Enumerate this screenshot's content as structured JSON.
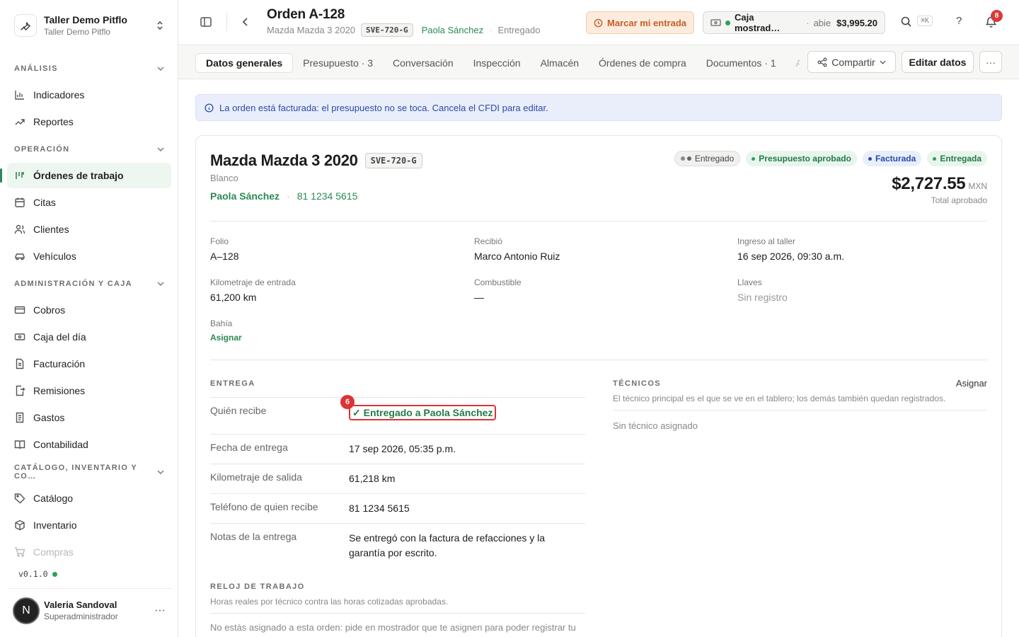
{
  "workspace": {
    "name": "Taller Demo Pitflo",
    "subtitle": "Taller Demo Pitflo"
  },
  "sidebar": {
    "sections": [
      {
        "title": "ANÁLISIS",
        "items": [
          {
            "label": "Indicadores",
            "icon": "bar-chart-icon"
          },
          {
            "label": "Reportes",
            "icon": "trend-icon"
          }
        ]
      },
      {
        "title": "OPERACIÓN",
        "items": [
          {
            "label": "Órdenes de trabajo",
            "icon": "kanban-icon",
            "active": true
          },
          {
            "label": "Citas",
            "icon": "calendar-icon"
          },
          {
            "label": "Clientes",
            "icon": "users-icon"
          },
          {
            "label": "Vehículos",
            "icon": "car-icon"
          }
        ]
      },
      {
        "title": "ADMINISTRACIÓN Y CAJA",
        "items": [
          {
            "label": "Cobros",
            "icon": "banknote-icon"
          },
          {
            "label": "Caja del día",
            "icon": "cash-icon"
          },
          {
            "label": "Facturación",
            "icon": "file-icon"
          },
          {
            "label": "Remisiones",
            "icon": "file-export-icon"
          },
          {
            "label": "Gastos",
            "icon": "receipt-icon"
          },
          {
            "label": "Contabilidad",
            "icon": "book-icon"
          }
        ]
      },
      {
        "title": "CATÁLOGO, INVENTARIO Y CO…",
        "items": [
          {
            "label": "Catálogo",
            "icon": "tag-icon"
          },
          {
            "label": "Inventario",
            "icon": "box-icon"
          },
          {
            "label": "Compras",
            "icon": "cart-icon"
          }
        ]
      }
    ],
    "version": "v0.1.0",
    "user": {
      "initial": "N",
      "name": "Valeria Sandoval",
      "role": "Superadministrador"
    }
  },
  "header": {
    "title": "Orden A-128",
    "vehicle": "Mazda Mazda 3 2020",
    "plate": "SVE-720-G",
    "customer": "Paola Sánchez",
    "status": "Entregado",
    "clock_in": "Marcar mi entrada",
    "cash": {
      "label": "Caja mostrad…",
      "state": "abie",
      "amount": "$3,995.20"
    },
    "shortcut": "⌘K",
    "help": "?",
    "notifications": "8"
  },
  "tabs": [
    "Datos generales",
    "Presupuesto · 3",
    "Conversación",
    "Inspección",
    "Almacén",
    "Órdenes de compra",
    "Documentos · 1",
    "Ad"
  ],
  "actions": {
    "share": "Compartir",
    "edit": "Editar datos",
    "more": "···"
  },
  "banner": "La orden está facturada: el presupuesto no se toca. Cancela el CFDI para editar.",
  "card": {
    "vehicle": "Mazda Mazda 3 2020",
    "plate": "SVE-720-G",
    "color": "Blanco",
    "owner": "Paola Sánchez",
    "phone": "81 1234 5615",
    "chips": [
      "Entregado",
      "Presupuesto aprobado",
      "Facturada",
      "Entregada"
    ],
    "total": "$2,727.55",
    "currency": "MXN",
    "total_label": "Total aprobado",
    "fields": {
      "folio": {
        "k": "Folio",
        "v": "A–128"
      },
      "received": {
        "k": "Recibió",
        "v": "Marco Antonio Ruiz"
      },
      "intake": {
        "k": "Ingreso al taller",
        "v": "16 sep 2026, 09:30 a.m."
      },
      "km_in": {
        "k": "Kilometraje de entrada",
        "v": "61,200 km"
      },
      "fuel": {
        "k": "Combustible",
        "v": "—"
      },
      "keys": {
        "k": "Llaves",
        "v": "Sin registro"
      },
      "bay": {
        "k": "Bahía",
        "v": "Asignar"
      }
    },
    "delivery": {
      "title": "ENTREGA",
      "who_k": "Quién recibe",
      "who_v": "✓ Entregado a Paola Sánchez",
      "marker": "6",
      "date_k": "Fecha de entrega",
      "date_v": "17 sep 2026, 05:35 p.m.",
      "km_k": "Kilometraje de salida",
      "km_v": "61,218 km",
      "phone_k": "Teléfono de quien recibe",
      "phone_v": "81 1234 5615",
      "notes_k": "Notas de la entrega",
      "notes_v": "Se entregó con la factura de refacciones y la garantía por escrito."
    },
    "techs": {
      "title": "TÉCNICOS",
      "assign": "Asignar",
      "note": "El técnico principal es el que se ve en el tablero; los demás también quedan registrados.",
      "empty": "Sin técnico asignado"
    },
    "clock": {
      "title": "RELOJ DE TRABAJO",
      "note": "Horas reales por técnico contra las horas cotizadas aprobadas.",
      "empty": "No estás asignado a esta orden: pide en mostrador que te asignen para poder registrar tu"
    }
  }
}
